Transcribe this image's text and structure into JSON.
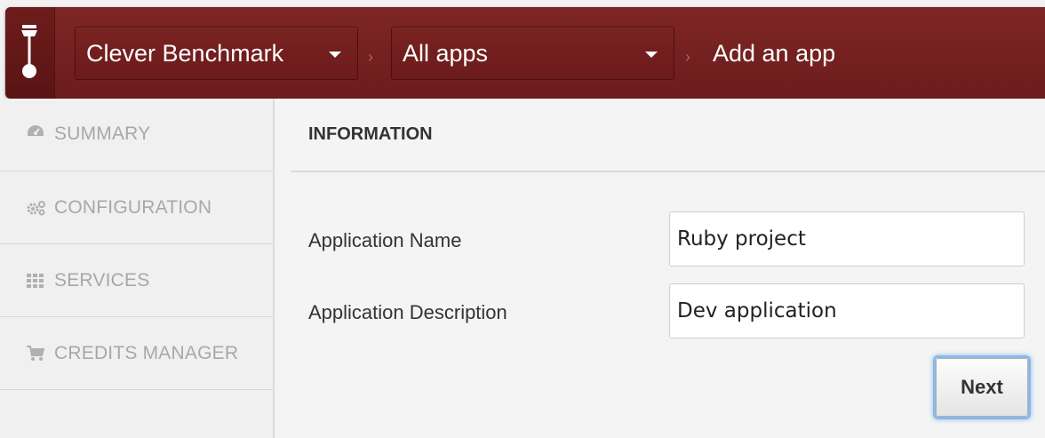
{
  "header": {
    "org_selector": "Clever Benchmark",
    "app_selector": "All apps",
    "current_page": "Add an app"
  },
  "sidebar": {
    "items": [
      {
        "label": "SUMMARY",
        "icon": "dashboard-icon"
      },
      {
        "label": "CONFIGURATION",
        "icon": "gears-icon"
      },
      {
        "label": "SERVICES",
        "icon": "grid-icon"
      },
      {
        "label": "CREDITS MANAGER",
        "icon": "cart-icon"
      }
    ]
  },
  "main": {
    "section_title": "INFORMATION",
    "fields": [
      {
        "label": "Application Name",
        "value": "Ruby project"
      },
      {
        "label": "Application Description",
        "value": "Dev application"
      }
    ],
    "next_label": "Next"
  },
  "colors": {
    "topbar": "#7d2323",
    "sidebar_text": "#a8a8a8",
    "focus_ring": "#8ab8e8"
  }
}
